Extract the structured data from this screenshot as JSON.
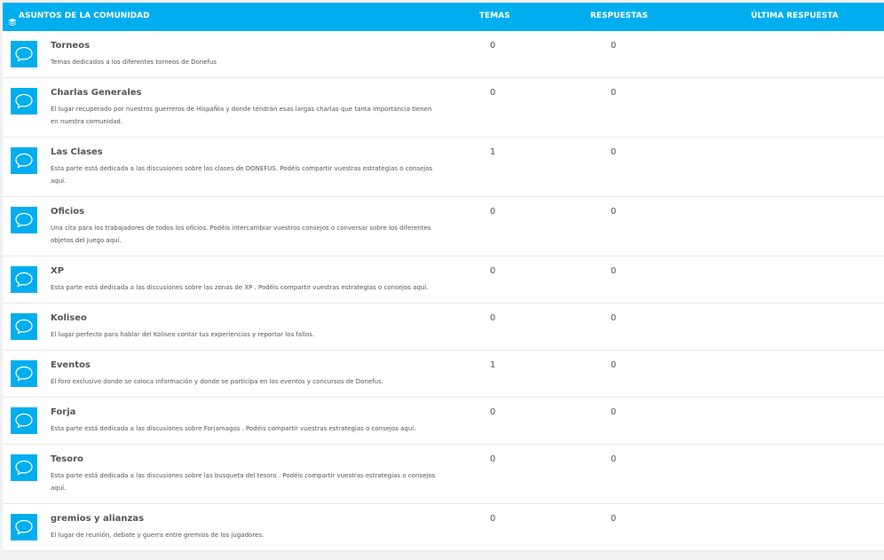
{
  "header": {
    "title": "ASUNTOS DE LA COMUNIDAD",
    "temas": "TEMAS",
    "respuestas": "RESPUESTAS",
    "ultima": "ÚLTIMA RESPUESTA",
    "icon": "layers-icon"
  },
  "colors": {
    "accent": "#00aeef",
    "text": "#555555",
    "background": "#f0f0f0"
  },
  "forums": [
    {
      "title": "Torneos",
      "desc": "Temas dedicados a los diferentes torneos de Donefus",
      "temas": "0",
      "respuestas": "0",
      "icon": "chat-bubble-icon"
    },
    {
      "title": "Charlas Generales",
      "desc": "El lugar recuperado por nuestros guerreros de HispaÑia y donde tendrán esas largas charlas que tanta importancia tienen en nuestra comunidad.",
      "temas": "0",
      "respuestas": "0",
      "icon": "chat-bubble-icon"
    },
    {
      "title": "Las Clases",
      "desc": "Esta parte está dedicada a las discusiones sobre las clases de DONEFUS. Podéis compartir vuestras estrategias o consejos aquí.",
      "temas": "1",
      "respuestas": "0",
      "icon": "chat-bubble-icon"
    },
    {
      "title": "Oficios",
      "desc": "Una cita para los trabajadores de todos los oficios. Podéis intercambiar vuestros consejos o conversar sobre los diferentes objetos del juego aquí.",
      "temas": "0",
      "respuestas": "0",
      "icon": "chat-bubble-icon"
    },
    {
      "title": "XP",
      "desc": "Esta parte está dedicada a las discusiones sobre las zonas de XP . Podéis compartir vuestras estrategias o consejos aquí.",
      "temas": "0",
      "respuestas": "0",
      "icon": "chat-bubble-icon"
    },
    {
      "title": "Koliseo",
      "desc": "El lugar perfecto para hablar del Koliseo contar tus experiencias y reportar los fallos.",
      "temas": "0",
      "respuestas": "0",
      "icon": "chat-bubble-icon"
    },
    {
      "title": "Eventos",
      "desc": "El foro exclusivo donde se coloca información y donde se participa en los eventos y concursos de Donefus.",
      "temas": "1",
      "respuestas": "0",
      "icon": "chat-bubble-icon"
    },
    {
      "title": "Forja",
      "desc": "Esta parte está dedicada a las discusiones sobre Forjamagos . Podéis compartir vuestras estrategias o consejos aquí.",
      "temas": "0",
      "respuestas": "0",
      "icon": "chat-bubble-icon"
    },
    {
      "title": "Tesoro",
      "desc": "Esta parte está dedicada a las discusiones sobre las busqueta del tesoro . Podéis compartir vuestras estrategias o consejos aquí.",
      "temas": "0",
      "respuestas": "0",
      "icon": "chat-bubble-icon"
    },
    {
      "title": "gremios y alianzas",
      "desc": "El lugar de reunión, debate y guerra entre gremios de los jugadores.",
      "temas": "0",
      "respuestas": "0",
      "icon": "chat-bubble-icon"
    }
  ]
}
